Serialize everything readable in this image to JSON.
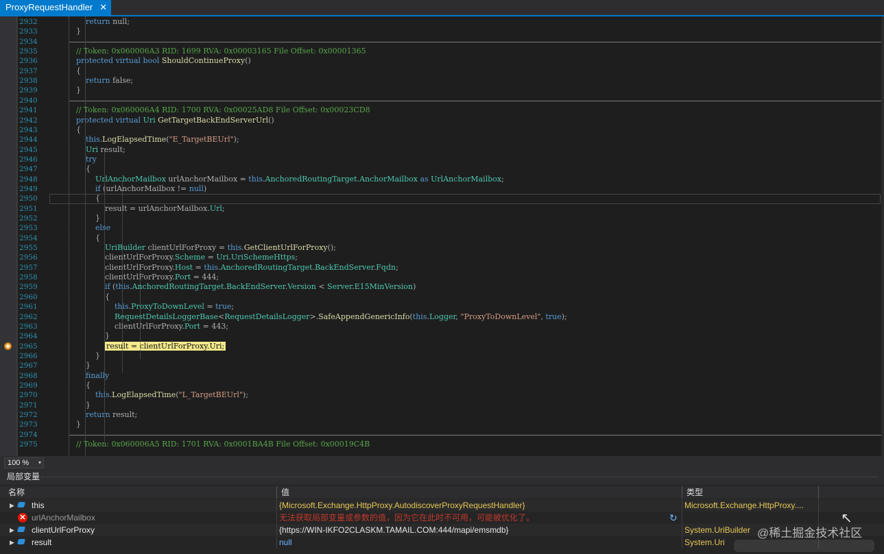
{
  "tab": {
    "title": "ProxyRequestHandler",
    "close": "✕"
  },
  "editor": {
    "lines": [
      {
        "n": "2932",
        "s": [
          [
            "        ",
            "p"
          ],
          [
            "return",
            "k"
          ],
          [
            " null;",
            "p"
          ]
        ]
      },
      {
        "n": "2933",
        "s": [
          [
            "    }",
            "p"
          ]
        ]
      },
      {
        "n": "2934",
        "s": []
      },
      {
        "n": "2935",
        "s": [
          [
            "    ",
            "p"
          ],
          [
            "// Token: 0x060006A3 RID: 1699 RVA: 0x00003165 File Offset: 0x00001365",
            "c"
          ]
        ]
      },
      {
        "n": "2936",
        "s": [
          [
            "    ",
            "p"
          ],
          [
            "protected virtual bool ",
            "k"
          ],
          [
            "ShouldContinueProxy",
            "m"
          ],
          [
            "()",
            "p"
          ]
        ]
      },
      {
        "n": "2937",
        "s": [
          [
            "    {",
            "p"
          ]
        ]
      },
      {
        "n": "2938",
        "s": [
          [
            "        ",
            "p"
          ],
          [
            "return",
            "k"
          ],
          [
            " false;",
            "p"
          ]
        ]
      },
      {
        "n": "2939",
        "s": [
          [
            "    }",
            "p"
          ]
        ]
      },
      {
        "n": "2940",
        "s": []
      },
      {
        "n": "2941",
        "s": [
          [
            "    ",
            "p"
          ],
          [
            "// Token: 0x060006A4 RID: 1700 RVA: 0x00025AD8 File Offset: 0x00023CD8",
            "c"
          ]
        ]
      },
      {
        "n": "2942",
        "s": [
          [
            "    ",
            "p"
          ],
          [
            "protected virtual ",
            "k"
          ],
          [
            "Uri ",
            "t"
          ],
          [
            "GetTargetBackEndServerUrl",
            "m"
          ],
          [
            "()",
            "p"
          ]
        ]
      },
      {
        "n": "2943",
        "s": [
          [
            "    {",
            "p"
          ]
        ]
      },
      {
        "n": "2944",
        "s": [
          [
            "        ",
            "p"
          ],
          [
            "this",
            "k"
          ],
          [
            ".",
            "p"
          ],
          [
            "LogElapsedTime",
            "m"
          ],
          [
            "(",
            "p"
          ],
          [
            "\"E_TargetBEUrl\"",
            "s"
          ],
          [
            ");",
            "p"
          ]
        ]
      },
      {
        "n": "2945",
        "s": [
          [
            "        ",
            "p"
          ],
          [
            "Uri",
            "t"
          ],
          [
            " result;",
            "p"
          ]
        ]
      },
      {
        "n": "2946",
        "s": [
          [
            "        ",
            "p"
          ],
          [
            "try",
            "k"
          ]
        ]
      },
      {
        "n": "2947",
        "s": [
          [
            "        {",
            "p"
          ]
        ]
      },
      {
        "n": "2948",
        "s": [
          [
            "            ",
            "p"
          ],
          [
            "UrlAnchorMailbox",
            "t"
          ],
          [
            " urlAnchorMailbox = ",
            "p"
          ],
          [
            "this",
            "k"
          ],
          [
            ".",
            "p"
          ],
          [
            "AnchoredRoutingTarget",
            "t"
          ],
          [
            ".",
            "p"
          ],
          [
            "AnchorMailbox",
            "t"
          ],
          [
            " as ",
            "k"
          ],
          [
            "UrlAnchorMailbox",
            "t"
          ],
          [
            ";",
            "p"
          ]
        ]
      },
      {
        "n": "2949",
        "s": [
          [
            "            ",
            "p"
          ],
          [
            "if",
            "k"
          ],
          [
            " (urlAnchorMailbox != ",
            "p"
          ],
          [
            "null",
            "k"
          ],
          [
            ")",
            "p"
          ]
        ]
      },
      {
        "n": "2950",
        "s": [
          [
            "            {",
            "p"
          ]
        ]
      },
      {
        "n": "2951",
        "s": [
          [
            "                result = urlAnchorMailbox.",
            "p"
          ],
          [
            "Url",
            "t"
          ],
          [
            ";",
            "p"
          ]
        ]
      },
      {
        "n": "2952",
        "s": [
          [
            "            }",
            "p"
          ]
        ]
      },
      {
        "n": "2953",
        "s": [
          [
            "            ",
            "p"
          ],
          [
            "else",
            "k"
          ]
        ]
      },
      {
        "n": "2954",
        "s": [
          [
            "            {",
            "p"
          ]
        ]
      },
      {
        "n": "2955",
        "s": [
          [
            "                ",
            "p"
          ],
          [
            "UriBuilder",
            "t"
          ],
          [
            " clientUrlForProxy = ",
            "p"
          ],
          [
            "this",
            "k"
          ],
          [
            ".",
            "p"
          ],
          [
            "GetClientUrlForProxy",
            "m"
          ],
          [
            "();",
            "p"
          ]
        ]
      },
      {
        "n": "2956",
        "s": [
          [
            "                clientUrlForProxy.",
            "p"
          ],
          [
            "Scheme",
            "t"
          ],
          [
            " = ",
            "p"
          ],
          [
            "Uri",
            "t"
          ],
          [
            ".",
            "p"
          ],
          [
            "UriSchemeHttps",
            "t"
          ],
          [
            ";",
            "p"
          ]
        ]
      },
      {
        "n": "2957",
        "s": [
          [
            "                clientUrlForProxy.",
            "p"
          ],
          [
            "Host",
            "t"
          ],
          [
            " = ",
            "p"
          ],
          [
            "this",
            "k"
          ],
          [
            ".",
            "p"
          ],
          [
            "AnchoredRoutingTarget",
            "t"
          ],
          [
            ".",
            "p"
          ],
          [
            "BackEndServer",
            "t"
          ],
          [
            ".",
            "p"
          ],
          [
            "Fqdn",
            "t"
          ],
          [
            ";",
            "p"
          ]
        ]
      },
      {
        "n": "2958",
        "s": [
          [
            "                clientUrlForProxy.",
            "p"
          ],
          [
            "Port",
            "t"
          ],
          [
            " = 444;",
            "p"
          ]
        ]
      },
      {
        "n": "2959",
        "s": [
          [
            "                ",
            "p"
          ],
          [
            "if",
            "k"
          ],
          [
            " (",
            "p"
          ],
          [
            "this",
            "k"
          ],
          [
            ".",
            "p"
          ],
          [
            "AnchoredRoutingTarget",
            "t"
          ],
          [
            ".",
            "p"
          ],
          [
            "BackEndServer",
            "t"
          ],
          [
            ".",
            "p"
          ],
          [
            "Version",
            "t"
          ],
          [
            " < ",
            "p"
          ],
          [
            "Server",
            "t"
          ],
          [
            ".",
            "p"
          ],
          [
            "E15MinVersion",
            "t"
          ],
          [
            ")",
            "p"
          ]
        ]
      },
      {
        "n": "2960",
        "s": [
          [
            "                {",
            "p"
          ]
        ]
      },
      {
        "n": "2961",
        "s": [
          [
            "                    ",
            "p"
          ],
          [
            "this",
            "k"
          ],
          [
            ".",
            "p"
          ],
          [
            "ProxyToDownLevel",
            "t"
          ],
          [
            " = ",
            "p"
          ],
          [
            "true",
            "k"
          ],
          [
            ";",
            "p"
          ]
        ]
      },
      {
        "n": "2962",
        "s": [
          [
            "                    ",
            "p"
          ],
          [
            "RequestDetailsLoggerBase",
            "t"
          ],
          [
            "<",
            "p"
          ],
          [
            "RequestDetailsLogger",
            "t"
          ],
          [
            ">.",
            "p"
          ],
          [
            "SafeAppendGenericInfo",
            "m"
          ],
          [
            "(",
            "p"
          ],
          [
            "this",
            "k"
          ],
          [
            ".",
            "p"
          ],
          [
            "Logger",
            "t"
          ],
          [
            ", ",
            "p"
          ],
          [
            "\"ProxyToDownLevel\"",
            "s"
          ],
          [
            ", ",
            "p"
          ],
          [
            "true",
            "k"
          ],
          [
            ");",
            "p"
          ]
        ]
      },
      {
        "n": "2963",
        "s": [
          [
            "                    clientUrlForProxy.",
            "p"
          ],
          [
            "Port",
            "t"
          ],
          [
            " = 443;",
            "p"
          ]
        ]
      },
      {
        "n": "2964",
        "s": [
          [
            "                }",
            "p"
          ]
        ]
      },
      {
        "n": "2965",
        "s": [
          [
            "                ",
            "p"
          ],
          [
            "result = clientUrlForProxy.Uri;",
            "hl"
          ]
        ]
      },
      {
        "n": "2966",
        "s": [
          [
            "            }",
            "p"
          ]
        ]
      },
      {
        "n": "2967",
        "s": [
          [
            "        }",
            "p"
          ]
        ]
      },
      {
        "n": "2968",
        "s": [
          [
            "        ",
            "p"
          ],
          [
            "finally",
            "k"
          ]
        ]
      },
      {
        "n": "2969",
        "s": [
          [
            "        {",
            "p"
          ]
        ]
      },
      {
        "n": "2970",
        "s": [
          [
            "            ",
            "p"
          ],
          [
            "this",
            "k"
          ],
          [
            ".",
            "p"
          ],
          [
            "LogElapsedTime",
            "m"
          ],
          [
            "(",
            "p"
          ],
          [
            "\"L_TargetBEUrl\"",
            "s"
          ],
          [
            ");",
            "p"
          ]
        ]
      },
      {
        "n": "2971",
        "s": [
          [
            "        }",
            "p"
          ]
        ]
      },
      {
        "n": "2972",
        "s": [
          [
            "        ",
            "p"
          ],
          [
            "return",
            "k"
          ],
          [
            " result;",
            "p"
          ]
        ]
      },
      {
        "n": "2973",
        "s": [
          [
            "    }",
            "p"
          ]
        ]
      },
      {
        "n": "2974",
        "s": []
      },
      {
        "n": "2975",
        "s": [
          [
            "    ",
            "p"
          ],
          [
            "// Token: 0x060006A5 RID: 1701 RVA: 0x0001BA4B File Offset: 0x00019C4B",
            "c"
          ]
        ]
      }
    ]
  },
  "zoom": {
    "value": "100 %",
    "arrow": "▾"
  },
  "locals": {
    "title": "局部变量",
    "headers": {
      "name": "名称",
      "value": "值",
      "type": "类型"
    },
    "rows": [
      {
        "expand": "▶",
        "icon": "variable-icon",
        "name": "this",
        "value": "{Microsoft.Exchange.HttpProxy.AutodiscoverProxyRequestHandler}",
        "value_color": "#e8c855",
        "type": "Microsoft.Exchange.HttpProxy...."
      },
      {
        "expand": "",
        "icon": "error-icon",
        "name": "urlAnchorMailbox",
        "value": "无法获取局部变量或参数的值，因为它在此时不可用，可能被优化了。",
        "value_color": "#c0392b",
        "type": ""
      },
      {
        "expand": "▶",
        "icon": "variable-icon",
        "name": "clientUrlForProxy",
        "value": "{https://WIN-IKFO2CLASKM.TAMAIL.COM:444/mapi/emsmdb}",
        "value_color": "#e8e8e8",
        "type": "System.UriBuilder"
      },
      {
        "expand": "▶",
        "icon": "variable-icon",
        "name": "result",
        "value": "null",
        "value_color": "#6cb6ff",
        "type": "System.Uri"
      }
    ]
  },
  "watermark": "@稀土掘金技术社区"
}
